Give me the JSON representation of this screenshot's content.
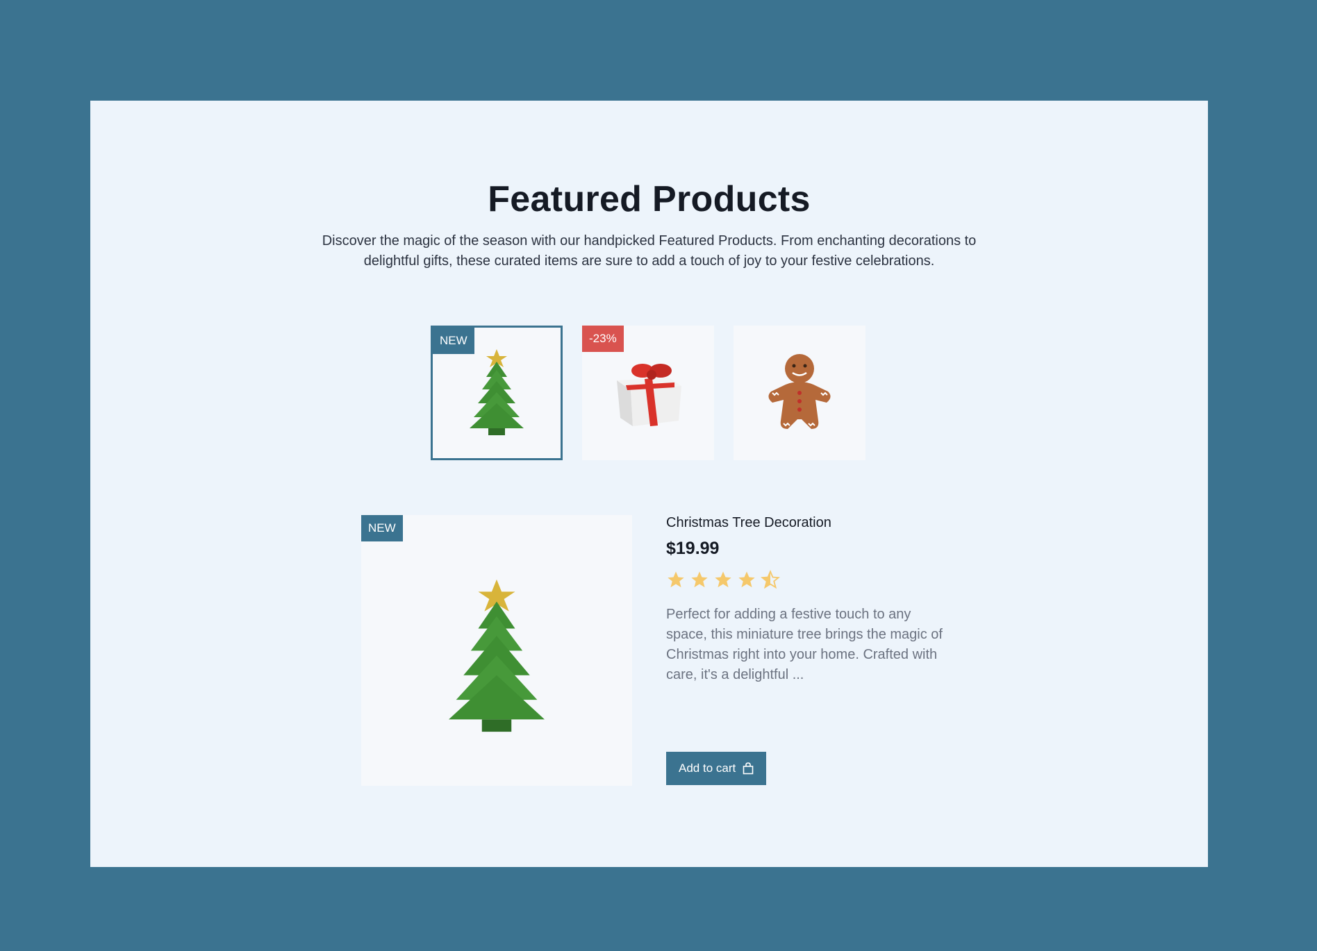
{
  "section": {
    "title": "Featured Products",
    "subtitle": "Discover the magic of the season with our handpicked Featured Products. From enchanting decorations to delightful gifts, these curated items are sure to add a touch of joy to your festive celebrations."
  },
  "thumbnails": [
    {
      "icon": "christmas-tree-icon",
      "badge": "NEW",
      "selected": true
    },
    {
      "icon": "gift-box-icon",
      "badge": "-23%",
      "selected": false
    },
    {
      "icon": "gingerbread-man-icon",
      "badge": "",
      "selected": false
    }
  ],
  "product": {
    "badge": "NEW",
    "name": "Christmas Tree Decoration",
    "price": "$19.99",
    "rating": 4.5,
    "description": "Perfect for adding a festive touch to any space, this miniature tree brings the magic of Christmas right into your home. Crafted with care, it's a delightful ...",
    "add_to_cart_label": "Add to cart",
    "image_icon": "christmas-tree-icon"
  },
  "colors": {
    "brand": "#3b7390",
    "sale_badge": "#d9534f",
    "star": "#f5c86b",
    "card_background": "#edf4fb"
  }
}
